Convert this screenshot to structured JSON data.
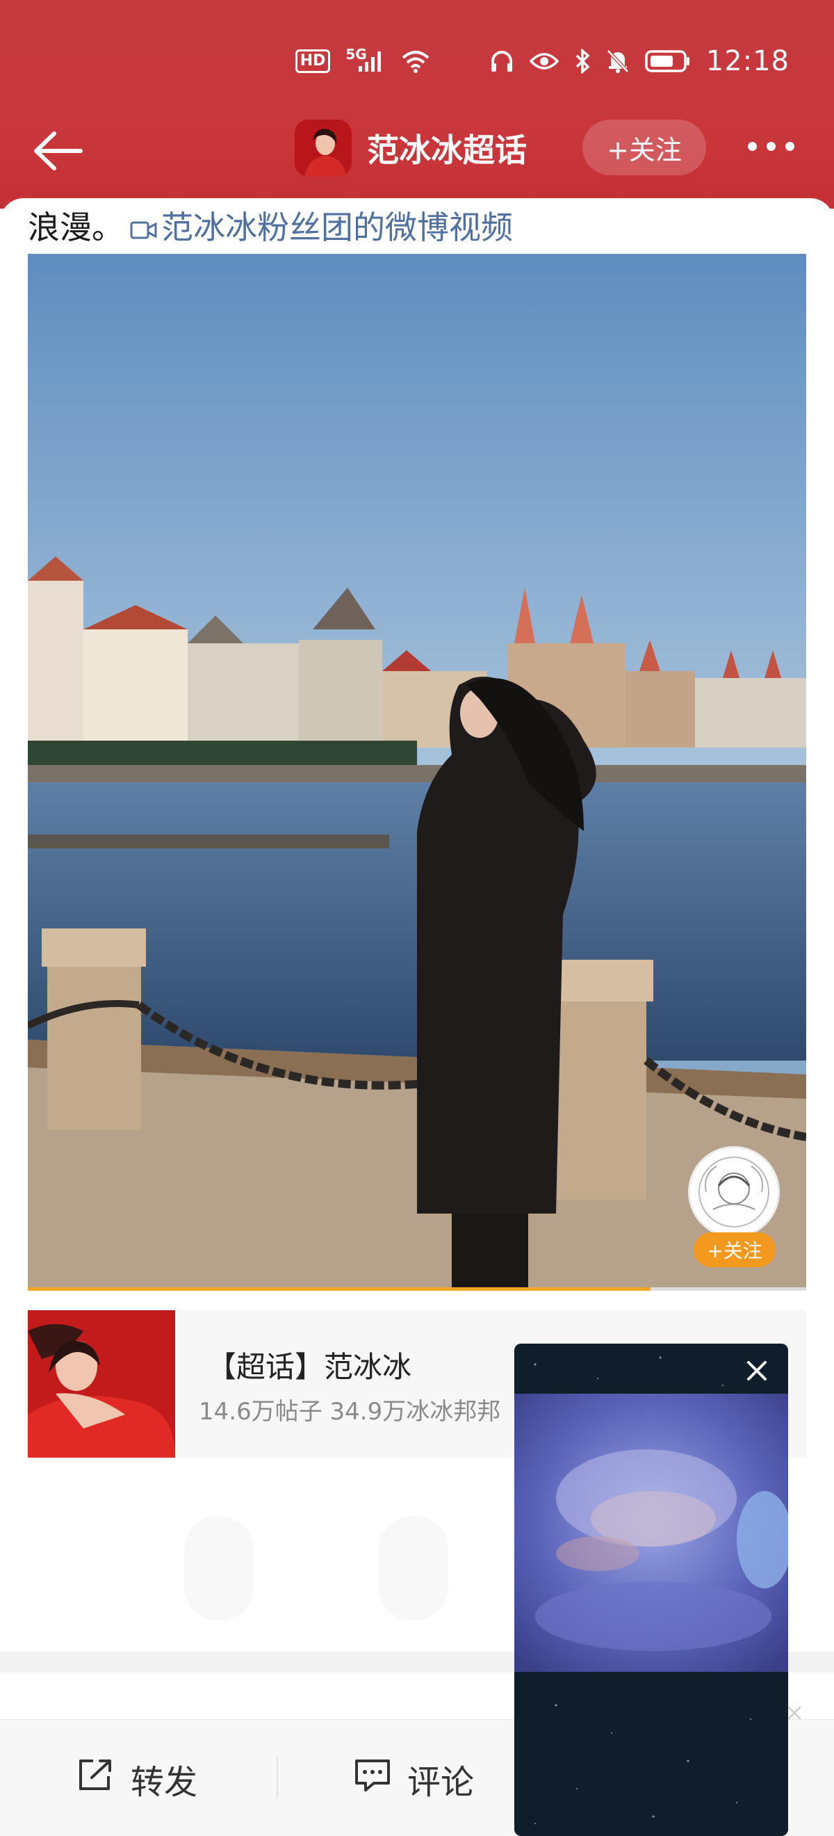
{
  "status_bar": {
    "hd_badge": "HD",
    "network": "5G",
    "time": "12:18",
    "icons": [
      "hd-icon",
      "signal-icon",
      "wifi-icon",
      "headphones-icon",
      "eye-icon",
      "bluetooth-icon",
      "mute-bell-icon",
      "battery-icon"
    ]
  },
  "header": {
    "title": "范冰冰超话",
    "follow_label": "+关注",
    "back_icon": "back-arrow-icon",
    "more_icon": "more-dots-icon"
  },
  "post": {
    "text": "浪漫。",
    "video_link": "范冰冰粉丝团的微博视频",
    "video_link_icon": "video-camera-icon"
  },
  "media": {
    "author_follow_label": "+关注",
    "progress": 0.8
  },
  "topic_card": {
    "title": "【超话】范冰冰",
    "stats": "14.6万帖子 34.9万冰冰邦邦"
  },
  "bottom_bar": {
    "repost_label": "转发",
    "comment_label": "评论"
  },
  "colors": {
    "header_red": "#c53a3e",
    "link_blue": "#5070a0",
    "follow_orange": "#f39a1e"
  }
}
